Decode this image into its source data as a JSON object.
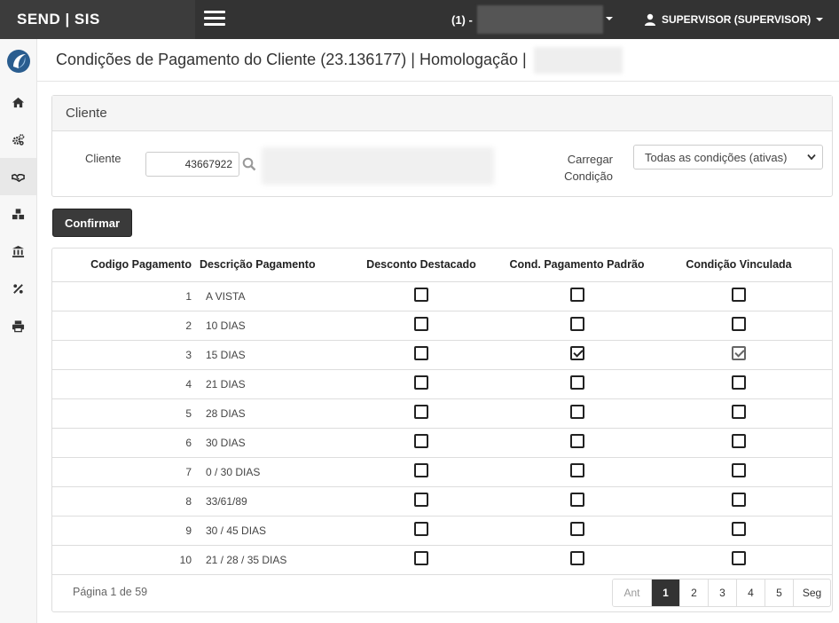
{
  "app": {
    "brand": "SEND | SIS"
  },
  "topbar": {
    "company_label": "(1) -",
    "user_label": "SUPERVISOR (SUPERVISOR)"
  },
  "sidebar": {
    "items": [
      {
        "name": "home-icon"
      },
      {
        "name": "gears-icon"
      },
      {
        "name": "handshake-icon"
      },
      {
        "name": "cubes-icon"
      },
      {
        "name": "bank-icon"
      },
      {
        "name": "percent-icon"
      },
      {
        "name": "print-icon"
      }
    ],
    "active_index": 2
  },
  "page": {
    "title": "Condições de Pagamento do Cliente (23.136177) | Homologação |"
  },
  "cliente_panel": {
    "heading": "Cliente",
    "cliente_label": "Cliente",
    "cliente_value": "43667922",
    "carregar_label_1": "Carregar",
    "carregar_label_2": "Condição",
    "condicao_selected": "Todas as condições (ativas)"
  },
  "actions": {
    "confirm_label": "Confirmar"
  },
  "table": {
    "headers": {
      "codigo": "Codigo Pagamento",
      "descricao": "Descrição Pagamento",
      "desconto": "Desconto Destacado",
      "padrao": "Cond. Pagamento Padrão",
      "vinculada": "Condição Vinculada"
    },
    "rows": [
      {
        "codigo": "1",
        "descricao": "A VISTA",
        "desconto": false,
        "padrao": false,
        "vinculada": false
      },
      {
        "codigo": "2",
        "descricao": "10 DIAS",
        "desconto": false,
        "padrao": false,
        "vinculada": false
      },
      {
        "codigo": "3",
        "descricao": "15 DIAS",
        "desconto": false,
        "padrao": true,
        "vinculada": true
      },
      {
        "codigo": "4",
        "descricao": "21 DIAS",
        "desconto": false,
        "padrao": false,
        "vinculada": false
      },
      {
        "codigo": "5",
        "descricao": "28 DIAS",
        "desconto": false,
        "padrao": false,
        "vinculada": false
      },
      {
        "codigo": "6",
        "descricao": "30 DIAS",
        "desconto": false,
        "padrao": false,
        "vinculada": false
      },
      {
        "codigo": "7",
        "descricao": "0 / 30 DIAS",
        "desconto": false,
        "padrao": false,
        "vinculada": false
      },
      {
        "codigo": "8",
        "descricao": "33/61/89",
        "desconto": false,
        "padrao": false,
        "vinculada": false
      },
      {
        "codigo": "9",
        "descricao": "30 / 45 DIAS",
        "desconto": false,
        "padrao": false,
        "vinculada": false
      },
      {
        "codigo": "10",
        "descricao": "21 / 28 / 35 DIAS",
        "desconto": false,
        "padrao": false,
        "vinculada": false
      }
    ]
  },
  "pagination": {
    "info": "Página 1 de 59",
    "prev_label": "Ant",
    "pages": [
      "1",
      "2",
      "3",
      "4",
      "5"
    ],
    "current": "1",
    "next_label": "Seg"
  }
}
